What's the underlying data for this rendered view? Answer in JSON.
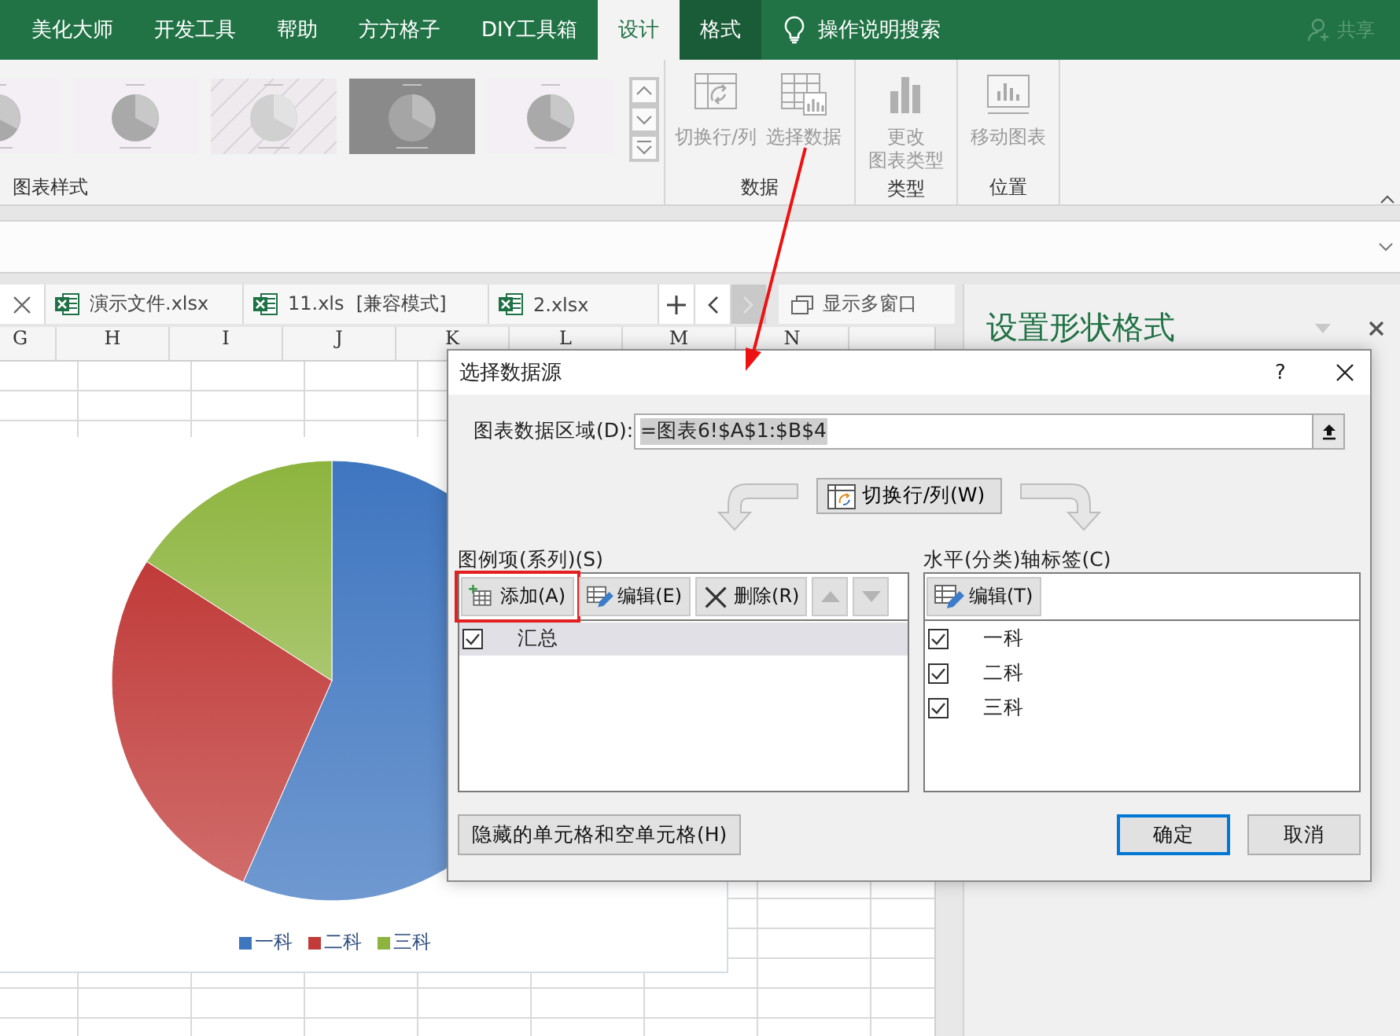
{
  "ribbon_tabs": [
    {
      "label": "美化大师",
      "selected": false,
      "kind": "standard"
    },
    {
      "label": "开发工具",
      "selected": false,
      "kind": "standard"
    },
    {
      "label": "帮助",
      "selected": false,
      "kind": "standard"
    },
    {
      "label": "方方格子",
      "selected": false,
      "kind": "standard"
    },
    {
      "label": "DIY工具箱",
      "selected": false,
      "kind": "standard"
    },
    {
      "label": "设计",
      "selected": true,
      "kind": "contextual"
    },
    {
      "label": "格式",
      "selected": false,
      "kind": "contextual"
    }
  ],
  "tell_me": "操作说明搜索",
  "share": {
    "label": "共享",
    "disabled": true
  },
  "chart_styles": {
    "label": "图表样式",
    "thumbnails": [
      {
        "kind": "plain"
      },
      {
        "kind": "plain"
      },
      {
        "kind": "hatched"
      },
      {
        "kind": "dark"
      },
      {
        "kind": "plain"
      }
    ]
  },
  "ribbon_groups": [
    {
      "label": "数据",
      "buttons": [
        {
          "label": "切换行/列",
          "kind": "switch",
          "disabled": true
        },
        {
          "label": "选择数据",
          "kind": "select",
          "disabled": true
        }
      ]
    },
    {
      "label": "类型",
      "buttons": [
        {
          "label_lines": [
            "更改",
            "图表类型"
          ],
          "kind": "type",
          "disabled": true
        }
      ]
    },
    {
      "label": "位置",
      "buttons": [
        {
          "label": "移动图表",
          "kind": "move",
          "disabled": true
        }
      ]
    }
  ],
  "workbook_tabs": [
    {
      "label": "演示文件.xlsx"
    },
    {
      "label": "11.xls  [兼容模式]"
    },
    {
      "label": "2.xlsx"
    }
  ],
  "show_windows": "显示多窗口",
  "columns": [
    "G",
    "H",
    "I",
    "J",
    "K",
    "L",
    "M",
    "N"
  ],
  "chart": {
    "legend": [
      {
        "label": "一科",
        "color": "#3f76c0"
      },
      {
        "label": "二科",
        "color": "#c03b39"
      },
      {
        "label": "三科",
        "color": "#8db43e"
      }
    ]
  },
  "pane": {
    "title": "设置形状格式"
  },
  "dialog": {
    "title": "选择数据源",
    "help": "?",
    "range_label": "图表数据区域(D):",
    "range_value": "=图表6!$A$1:$B$4",
    "switch_button": "切换行/列(W)",
    "series_label": "图例项(系列)(S)",
    "series_buttons": [
      {
        "kind": "add",
        "label": "添加(A)",
        "disabled": false,
        "highlighted": true
      },
      {
        "kind": "edit",
        "label": "编辑(E)",
        "disabled": false,
        "highlighted": false
      },
      {
        "kind": "delete",
        "label": "删除(R)",
        "disabled": false,
        "highlighted": false
      },
      {
        "kind": "up",
        "disabled": true,
        "highlighted": false
      },
      {
        "kind": "down",
        "disabled": true,
        "highlighted": false
      }
    ],
    "series": [
      {
        "label": "汇总",
        "checked": true,
        "selected": true
      }
    ],
    "axis_label": "水平(分类)轴标签(C)",
    "axis_button": "编辑(T)",
    "axis_items": [
      {
        "label": "一科",
        "checked": true,
        "selected": false
      },
      {
        "label": "二科",
        "checked": true,
        "selected": false
      },
      {
        "label": "三科",
        "checked": true,
        "selected": false
      }
    ],
    "hidden_cells_button": "隐藏的单元格和空单元格(H)",
    "footer_buttons": [
      {
        "label": "确定",
        "default": true
      },
      {
        "label": "取消",
        "default": false
      }
    ]
  },
  "annotation": {
    "kind": "arrow"
  }
}
